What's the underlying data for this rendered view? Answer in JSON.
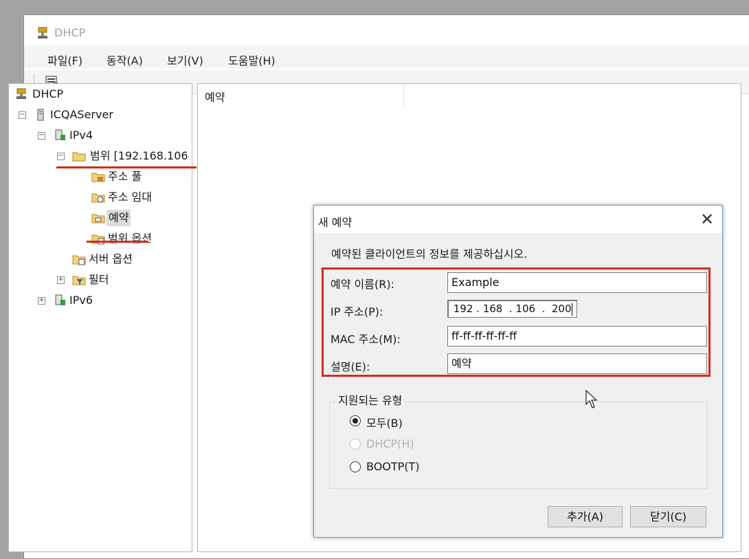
{
  "window": {
    "title": "DHCP"
  },
  "menu": [
    "파일(F)",
    "동작(A)",
    "보기(V)",
    "도움말(H)"
  ],
  "tree": {
    "root": "DHCP",
    "server": "ICQAServer",
    "ipv4": "IPv4",
    "scope": "범위 [192.168.106",
    "address_pool": "주소 풀",
    "address_leases": "주소 임대",
    "reservations": "예약",
    "scope_options": "범위 옵션",
    "server_options": "서버 옵션",
    "filters": "필터",
    "ipv6": "IPv6"
  },
  "content": {
    "column_header": "예약"
  },
  "dialog": {
    "title": "새 예약",
    "close_glyph": "✕",
    "instruction": "예약된 클라이언트의 정보를 제공하십시오.",
    "fields": {
      "name_label": "예약 이름(R):",
      "name_value": "Example",
      "ip_label": "IP 주소(P):",
      "ip_value": " 192 . 168  . 106  .  200",
      "mac_label": "MAC 주소(M):",
      "mac_value": "ff-ff-ff-ff-ff-ff",
      "desc_label": "설명(E):",
      "desc_value": "예약"
    },
    "group": {
      "label": "지원되는 유형",
      "options": [
        {
          "label": "모두(B)",
          "checked": true,
          "enabled": true
        },
        {
          "label": "DHCP(H)",
          "checked": false,
          "enabled": false
        },
        {
          "label": "BOOTP(T)",
          "checked": false,
          "enabled": true
        }
      ]
    },
    "buttons": {
      "add": "추가(A)",
      "close": "닫기(C)"
    }
  },
  "colors": {
    "highlight": "#d52b1e",
    "dialog_border": "#6b93c4"
  },
  "icons": [
    "dhcp-server-icon",
    "server-icon",
    "ipv4-icon",
    "folder-icon",
    "address-pool-icon",
    "address-lease-icon",
    "reservation-icon",
    "scope-options-icon",
    "server-options-icon",
    "filter-icon",
    "mouse-cursor-icon"
  ]
}
